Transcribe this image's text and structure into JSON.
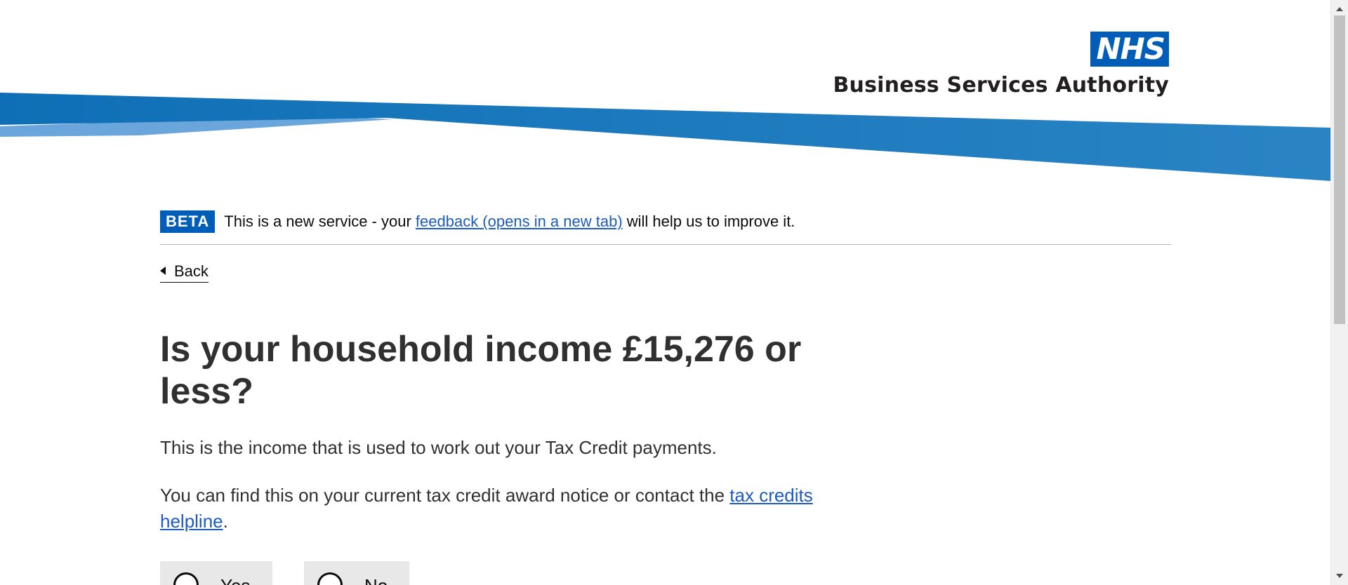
{
  "header": {
    "logo_text": "NHS",
    "org_name": "Business Services Authority"
  },
  "phase_banner": {
    "tag": "BETA",
    "text_before": "This is a new service - your ",
    "feedback_link": "feedback (opens in a new tab)",
    "text_after": " will help us to improve it."
  },
  "back_link": "Back",
  "question": {
    "heading": "Is your household income £15,276 or less?",
    "paragraph_1": "This is the income that is used to work out your Tax Credit payments.",
    "paragraph_2_before": "You can find this on your current tax credit award notice or contact the ",
    "paragraph_2_link": "tax credits helpline",
    "paragraph_2_after": "."
  },
  "options": [
    {
      "label": "Yes"
    },
    {
      "label": "No"
    }
  ],
  "colors": {
    "nhs_blue": "#005eb8",
    "link": "#1d5bbf",
    "banner_blue": "#1f7ab8",
    "banner_light": "#6aa6dc",
    "radio_background": "#e8e8e8"
  }
}
